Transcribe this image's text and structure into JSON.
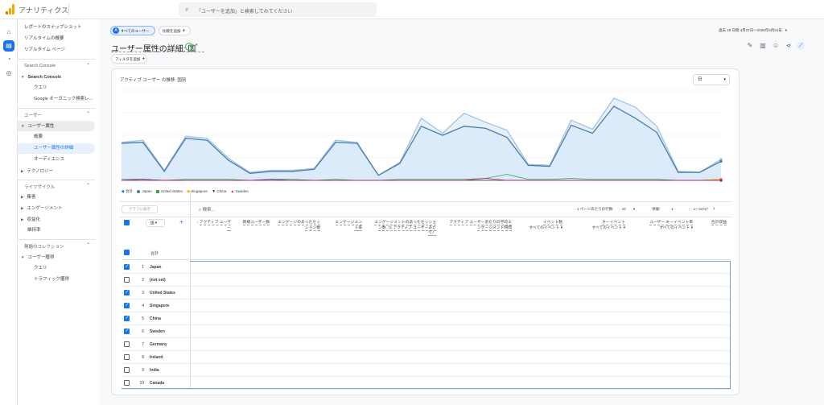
{
  "app": {
    "title": "アナリティクス",
    "search_placeholder": "「ユーザーを追加」と検索してみてください",
    "brand_colors": [
      "#f9ab00",
      "#e37400"
    ]
  },
  "rail": [
    "home-icon",
    "reports-icon",
    "explore-icon",
    "advertising-icon"
  ],
  "nav": {
    "top_items": [
      "レポートのスナップショット",
      "リアルタイムの概要",
      "リアルタイム ページ"
    ],
    "search_console": {
      "section": "Search Console",
      "group": "Search Console",
      "children": [
        "クエリ",
        "Google オーガニック検索レ..."
      ]
    },
    "user": {
      "section": "ユーザー",
      "group": "ユーザー属性",
      "children": [
        "概要",
        "ユーザー属性の詳細",
        "オーディエンス"
      ],
      "tech": "テクノロジー"
    },
    "lifecycle": {
      "section": "ライフサイクル",
      "items": [
        "集客",
        "エンゲージメント",
        "収益化",
        "維持率"
      ]
    },
    "untitled": {
      "section": "無題のコレクション",
      "group": "ユーザー獲得",
      "children": [
        "クエリ",
        "トラフィック獲得"
      ]
    }
  },
  "header": {
    "segment_chip": "すべてのユーザー",
    "compare_chip": "比較を追加",
    "title": "ユーザー属性の詳細: 国",
    "filter_chip": "フィルタを追加",
    "date_range": "過去 28 日間  4月27日～2026年5月24日"
  },
  "chart": {
    "card_title": "アクティブ ユーザー の推移: 国別",
    "granularity": "日",
    "legend": [
      "合計",
      "Japan",
      "United States",
      "Singapore",
      "China",
      "Sweden"
    ],
    "colors": {
      "total": "#9fc5e8",
      "Japan": "#4a7cae",
      "United States": "#34a853",
      "Singapore": "#f9ab00",
      "China": "#283593",
      "Sweden": "#d81b60"
    }
  },
  "chart_data": {
    "type": "area",
    "x": [
      1,
      2,
      3,
      4,
      5,
      6,
      7,
      8,
      9,
      10,
      11,
      12,
      13,
      14,
      15,
      16,
      17,
      18,
      19,
      20,
      21,
      22,
      23,
      24,
      25,
      26,
      27,
      28,
      29
    ],
    "series": [
      {
        "name": "合計",
        "values": [
          38,
          40,
          10,
          44,
          42,
          22,
          8,
          10,
          10,
          12,
          40,
          38,
          5,
          18,
          62,
          47,
          67,
          58,
          50,
          16,
          15,
          60,
          51,
          82,
          73,
          54,
          9,
          8,
          21
        ]
      },
      {
        "name": "Japan",
        "values": [
          37,
          38,
          9,
          42,
          40,
          20,
          7,
          9,
          9,
          11,
          38,
          37,
          5,
          17,
          54,
          45,
          54,
          52,
          43,
          15,
          14,
          55,
          47,
          74,
          62,
          48,
          8,
          8,
          19
        ]
      },
      {
        "name": "United States",
        "values": [
          1,
          1,
          0,
          1,
          1,
          1,
          0,
          1,
          1,
          0,
          1,
          0,
          0,
          1,
          1,
          1,
          1,
          2,
          6,
          1,
          1,
          2,
          1,
          1,
          1,
          1,
          0,
          0,
          1
        ]
      },
      {
        "name": "Singapore",
        "values": [
          0,
          0,
          0,
          0,
          0,
          0,
          0,
          0,
          0,
          0,
          0,
          0,
          0,
          0,
          0,
          0,
          0,
          0,
          0,
          0,
          0,
          0,
          0,
          0,
          0,
          0,
          0,
          0,
          1
        ]
      },
      {
        "name": "China",
        "values": [
          0,
          1,
          0,
          0,
          0,
          0,
          0,
          1,
          0,
          0,
          0,
          0,
          0,
          0,
          0,
          0,
          0,
          0,
          0,
          0,
          0,
          0,
          0,
          0,
          0,
          0,
          0,
          0,
          0
        ]
      },
      {
        "name": "Sweden",
        "values": [
          0,
          0,
          0,
          0,
          0,
          0,
          0,
          0,
          0,
          0,
          0,
          0,
          0,
          0,
          0,
          0,
          0,
          2,
          0,
          0,
          0,
          0,
          0,
          0,
          0,
          0,
          0,
          0,
          0
        ]
      }
    ],
    "ylim": [
      0,
      90
    ],
    "grid": true,
    "legend_position": "bottom-left"
  },
  "table": {
    "plot_button": "グラフに表示",
    "search_placeholder": "検索...",
    "rows_per_page_label": "1 ページあたりの行数:",
    "rows_per_page": "10",
    "goto_label": "移動:",
    "goto_value": "1",
    "range": "1～10/17",
    "dimension_chip": "国",
    "total_label": "合計",
    "headers": [
      "アクティブ ユーザー",
      "新規ユーザー数",
      "エンゲージのあったセッション数",
      "エンゲージメント率",
      "エンゲージメントのあったセッション数（1 アクティブ ユーザーあたり）",
      "アクティブ ユーザーあたりの平均エンゲージメント時間",
      "イベント数",
      "キーイベント",
      "ユーザー キーイベント率",
      "合計収益"
    ],
    "sub_selects": [
      "すべてのイベント",
      "すべてのイベント",
      "すべてのイベント"
    ],
    "rows": [
      {
        "n": "1",
        "label": "Japan",
        "checked": true
      },
      {
        "n": "2",
        "label": "(not set)",
        "checked": false
      },
      {
        "n": "3",
        "label": "United States",
        "checked": true
      },
      {
        "n": "4",
        "label": "Singapore",
        "checked": true
      },
      {
        "n": "5",
        "label": "China",
        "checked": true
      },
      {
        "n": "6",
        "label": "Sweden",
        "checked": true
      },
      {
        "n": "7",
        "label": "Germany",
        "checked": false
      },
      {
        "n": "8",
        "label": "Ireland",
        "checked": false
      },
      {
        "n": "9",
        "label": "India",
        "checked": false
      },
      {
        "n": "10",
        "label": "Canada",
        "checked": false
      }
    ]
  }
}
